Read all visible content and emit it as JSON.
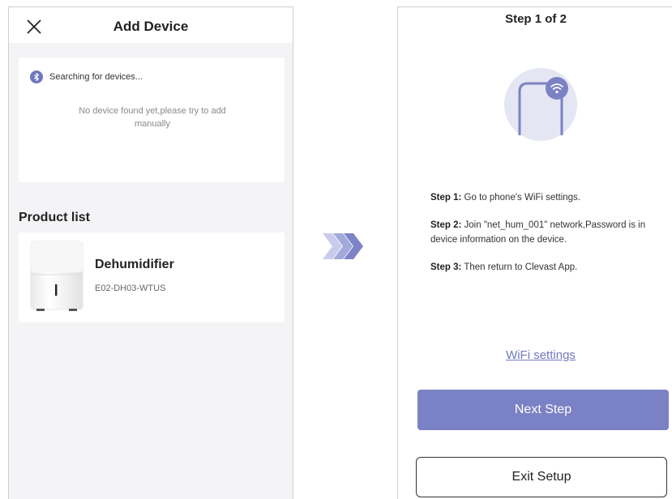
{
  "add_device": {
    "title": "Add Device",
    "search_status": "Searching for devices...",
    "empty_message": "No device found yet,please try to add manually",
    "product_list_heading": "Product list",
    "products": [
      {
        "name": "Dehumidifier",
        "model": "E02-DH03-WTUS",
        "icon": "dehumidifier-icon"
      }
    ]
  },
  "setup": {
    "step_title": "Step 1 of 2",
    "steps": [
      {
        "label": "Step 1:",
        "text": " Go to phone's WiFi settings."
      },
      {
        "label": "Step 2:",
        "text": " Join \"net_hum_001\" network,Password is in device information on the device."
      },
      {
        "label": "Step 3:",
        "text": " Then return to Clevast App."
      }
    ],
    "wifi_link": "WiFi settings",
    "next_button": "Next Step",
    "exit_button": "Exit Setup"
  },
  "icons": {
    "close": "close-icon",
    "bluetooth": "bluetooth-icon",
    "phone_wifi": "phone-wifi-icon",
    "arrow": "chevron-arrows-icon"
  },
  "colors": {
    "accent": "#7a81c4",
    "link": "#7079c2",
    "illustration_bg": "#e4e6f3",
    "left_bg": "#f4f4f6"
  }
}
